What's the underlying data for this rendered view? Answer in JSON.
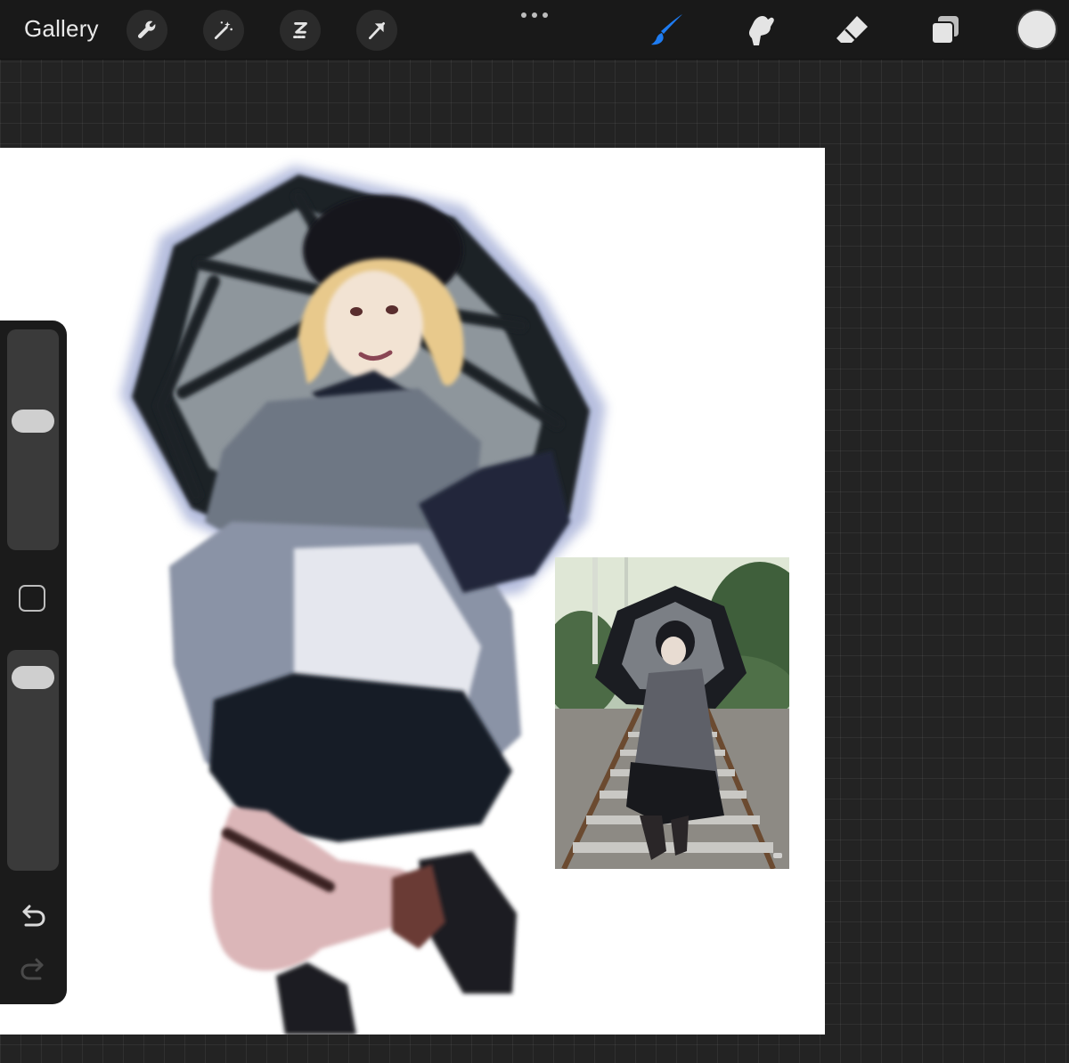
{
  "toolbar": {
    "gallery_label": "Gallery",
    "left_tools": [
      "wrench-icon",
      "magic-wand-icon",
      "selection-icon",
      "transform-arrow-icon"
    ],
    "right_tools": [
      "brush-icon",
      "smudge-icon",
      "eraser-icon",
      "layers-icon"
    ],
    "active_tool": "brush",
    "active_color": "#e6e6e6",
    "accent_color": "#1e7cf2"
  },
  "sidebar": {
    "brush_size_level": 0.6,
    "opacity_level": 0.94,
    "controls": [
      "brush-size-slider",
      "modify-button",
      "opacity-slider",
      "undo-icon",
      "redo-icon"
    ]
  },
  "canvas": {
    "background_color": "#ffffff",
    "reference_image": "reference-photo"
  }
}
